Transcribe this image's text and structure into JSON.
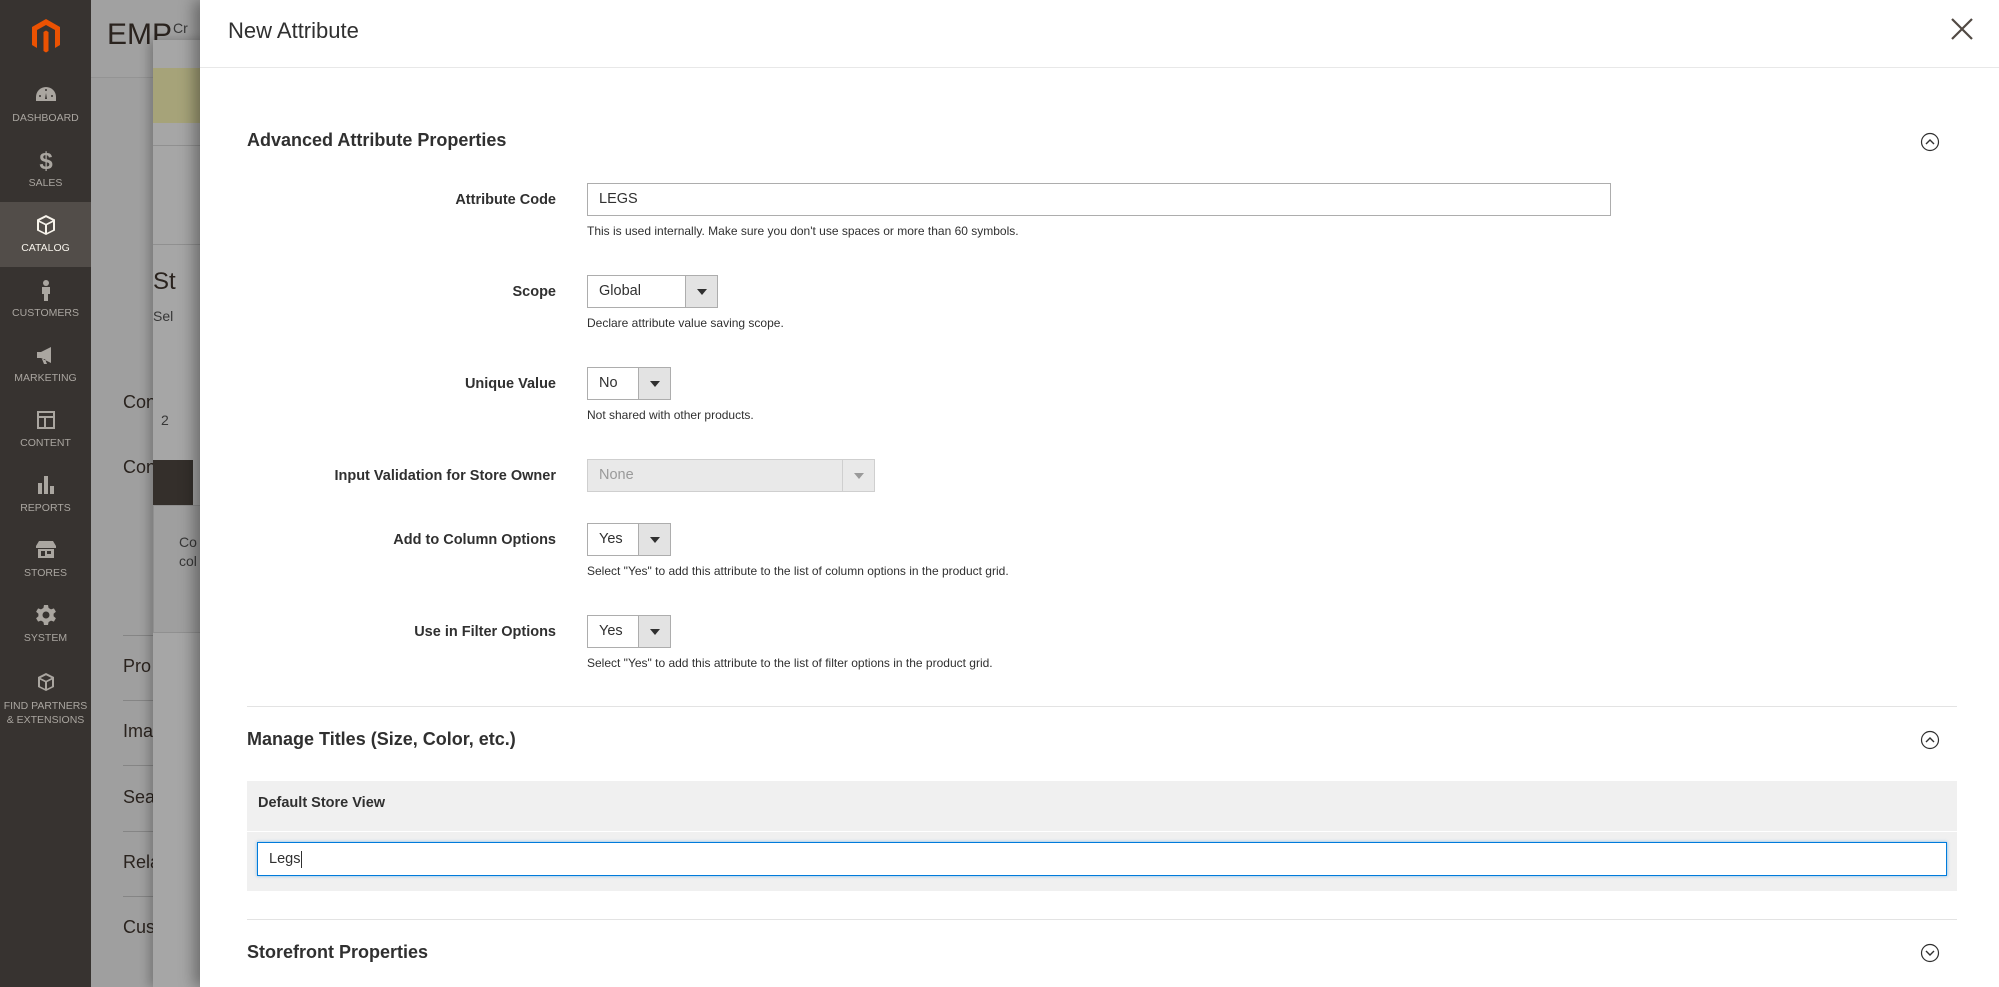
{
  "nav": {
    "items": [
      {
        "label": "Dashboard",
        "icon": "dashboard-icon"
      },
      {
        "label": "Sales",
        "icon": "dollar-icon"
      },
      {
        "label": "Catalog",
        "icon": "box-icon",
        "active": true
      },
      {
        "label": "Customers",
        "icon": "person-icon"
      },
      {
        "label": "Marketing",
        "icon": "megaphone-icon"
      },
      {
        "label": "Content",
        "icon": "layout-icon"
      },
      {
        "label": "Reports",
        "icon": "bar-chart-icon"
      },
      {
        "label": "Stores",
        "icon": "storefront-icon"
      },
      {
        "label": "System",
        "icon": "gear-icon"
      },
      {
        "label": "Find Partners & Extensions",
        "icon": "cubes-icon"
      }
    ]
  },
  "bg": {
    "title": "EMP",
    "crumb": "Cr",
    "step_title": "St",
    "step_sub": "Sel",
    "sections": [
      "Con",
      "Con",
      "Pro",
      "Ima",
      "Sea",
      "Rela",
      "Cus"
    ],
    "count": "2",
    "note_line1": "Co",
    "note_line2": "col"
  },
  "modal": {
    "title": "New Attribute",
    "advanced": {
      "title": "Advanced Attribute Properties",
      "attribute_code": {
        "label": "Attribute Code",
        "value": "LEGS",
        "note": "This is used internally. Make sure you don't use spaces or more than 60 symbols."
      },
      "scope": {
        "label": "Scope",
        "value": "Global",
        "note": "Declare attribute value saving scope."
      },
      "unique_value": {
        "label": "Unique Value",
        "value": "No",
        "note": "Not shared with other products."
      },
      "input_validation": {
        "label": "Input Validation for Store Owner",
        "value": "None"
      },
      "add_to_column": {
        "label": "Add to Column Options",
        "value": "Yes",
        "note": "Select \"Yes\" to add this attribute to the list of column options in the product grid."
      },
      "use_in_filter": {
        "label": "Use in Filter Options",
        "value": "Yes",
        "note": "Select \"Yes\" to add this attribute to the list of filter options in the product grid."
      }
    },
    "manage_titles": {
      "title": "Manage Titles (Size, Color, etc.)",
      "column_header": "Default Store View",
      "value": "Legs"
    },
    "storefront": {
      "title": "Storefront Properties"
    }
  }
}
